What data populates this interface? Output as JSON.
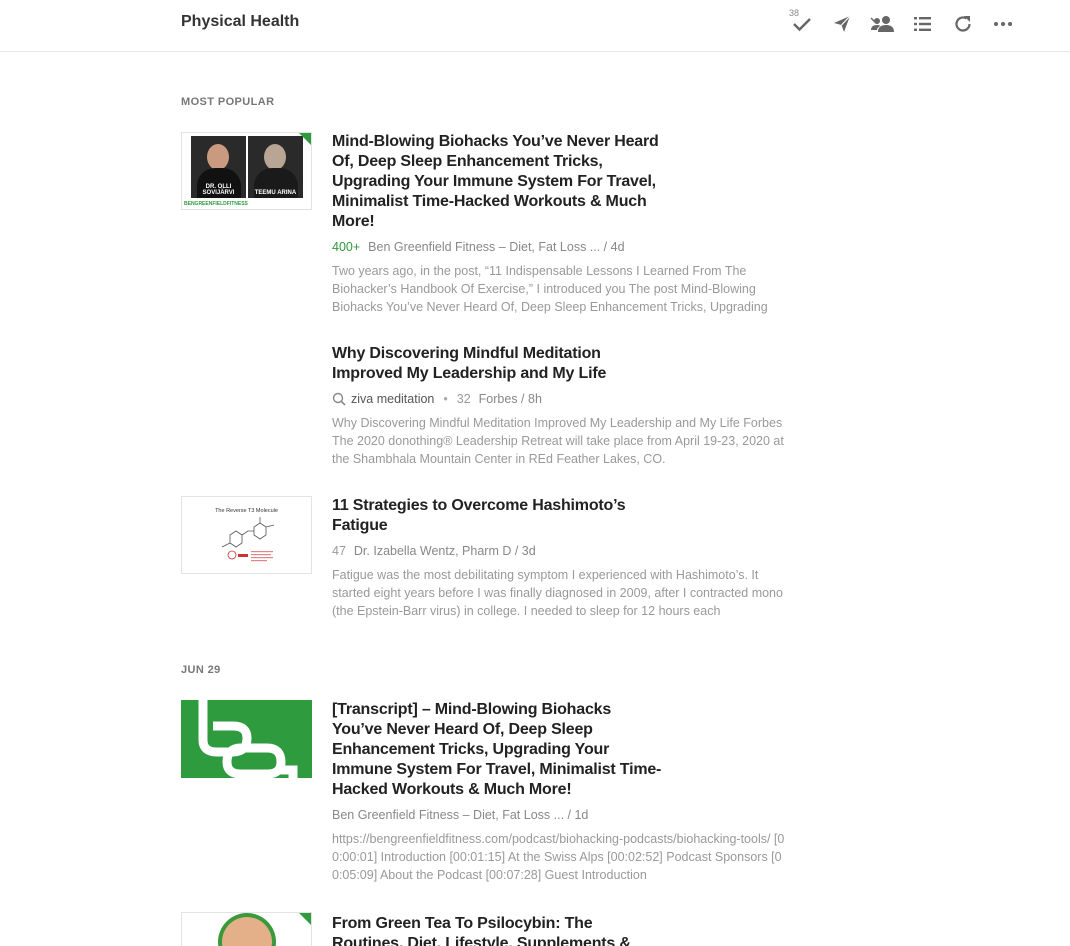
{
  "header": {
    "title": "Physical Health",
    "mark_read_count": "38"
  },
  "sections": {
    "most_popular": "MOST POPULAR",
    "date_group": "JUN 29"
  },
  "entries": [
    {
      "title": "Mind-Blowing Biohacks You’ve Never Heard Of, Deep Sleep Enhancement Tricks, Upgrading Your Immune System For Travel, Minimalist Time-Hacked Workouts & Much More!",
      "popularity": "400+",
      "source": "Ben Greenfield Fitness – Diet, Fat Loss ... / 4d",
      "summary": "Two years ago, in the post, “11 Indispensable Lessons I Learned From The Biohacker’s Handbook Of Exercise,” I introduced you The post Mind-Blowing Biohacks You’ve Never Heard Of, Deep Sleep Enhancement Tricks, Upgrading",
      "thumb_captions": [
        "DR. OLLI SOVIJÄRVI",
        "TEEMU ARINA"
      ],
      "thumb_brand": "BENGREENFIELDFITNESS"
    },
    {
      "title": "Why Discovering Mindful Meditation Improved My Leadership and My Life",
      "query": "ziva meditation",
      "count": "32",
      "source": "Forbes / 8h",
      "summary": "Why Discovering Mindful Meditation Improved My Leadership and My Life Forbes The 2020 donothing® Leadership Retreat will take place from April 19-23, 2020 at the Shambhala Mountain Center in REd Feather Lakes, CO."
    },
    {
      "title": "11 Strategies to Overcome Hashimoto’s Fatigue",
      "count": "47",
      "source": "Dr. Izabella Wentz, Pharm D / 3d",
      "summary": "Fatigue was the most debilitating symptom I experienced with Hashimoto’s. It started eight years before I was finally diagnosed in 2009, after I contracted mono (the Epstein-Barr virus) in college. I needed to sleep for 12 hours each",
      "thumb_title": "The Reverse T3 Molecule"
    },
    {
      "title": "[Transcript] – Mind-Blowing Biohacks You’ve Never Heard Of, Deep Sleep Enhancement Tricks, Upgrading Your Immune System For Travel, Minimalist Time-Hacked Workouts & Much More!",
      "source": "Ben Greenfield Fitness – Diet, Fat Loss ... / 1d",
      "summary": "https://bengreenfieldfitness.com/podcast/biohacking-podcasts/biohacking-tools/ [00:00:01] Introduction [00:01:15] At the Swiss Alps [00:02:52] Podcast Sponsors [00:05:09] About the Podcast [00:07:28] Guest Introduction"
    },
    {
      "title": "From Green Tea To Psilocybin: The Routines, Diet, Lifestyle, Supplements & Sage Advice"
    }
  ],
  "colors": {
    "accent": "#2e9b3e",
    "text": "#222222",
    "muted": "#999999"
  },
  "icons": [
    "mark-read-icon",
    "share-icon",
    "team-icon",
    "list-view-icon",
    "refresh-icon",
    "more-icon",
    "search-icon"
  ]
}
